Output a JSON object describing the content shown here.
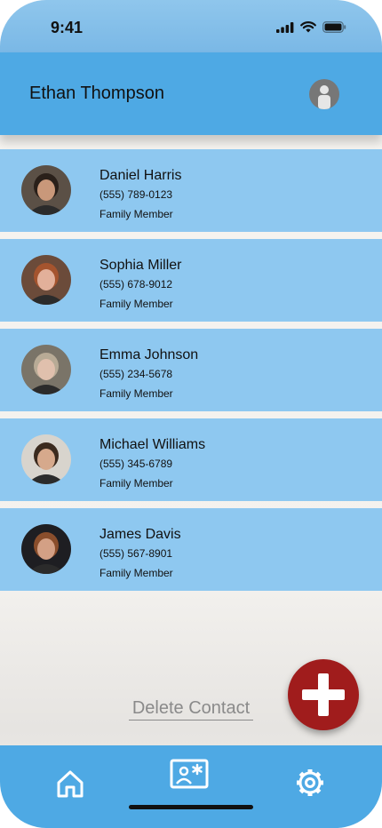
{
  "status_bar": {
    "time": "9:41"
  },
  "header": {
    "user_name": "Ethan Thompson"
  },
  "contacts": [
    {
      "name": "Daniel Harris",
      "phone": "(555) 789-0123",
      "relation": "Family Member",
      "avatar_bg": "#5b5046",
      "avatar_skin": "#c9987a",
      "avatar_hair": "#2a201a"
    },
    {
      "name": "Sophia Miller",
      "phone": "(555) 678-9012",
      "relation": "Family Member",
      "avatar_bg": "#6b4b3a",
      "avatar_skin": "#e2b09a",
      "avatar_hair": "#a5542e"
    },
    {
      "name": "Emma Johnson",
      "phone": "(555) 234-5678",
      "relation": "Family Member",
      "avatar_bg": "#7a7468",
      "avatar_skin": "#e0c0ad",
      "avatar_hair": "#b8ab96"
    },
    {
      "name": "Michael Williams",
      "phone": "(555) 345-6789",
      "relation": "Family Member",
      "avatar_bg": "#d8d4cd",
      "avatar_skin": "#d6a98c",
      "avatar_hair": "#3b2a1e"
    },
    {
      "name": "James Davis",
      "phone": "(555) 567-8901",
      "relation": "Family Member",
      "avatar_bg": "#1e1e22",
      "avatar_skin": "#d3a085",
      "avatar_hair": "#8a4e2c"
    }
  ],
  "actions": {
    "delete_contact": "Delete Contact"
  },
  "icons": {
    "profile": "person-icon",
    "add": "plus-icon",
    "home": "home-icon",
    "contacts": "contact-card-icon",
    "settings": "gear-icon"
  },
  "colors": {
    "header": "#4ea9e4",
    "contact_row": "#8ec8f0",
    "fab": "#a01c1c"
  }
}
